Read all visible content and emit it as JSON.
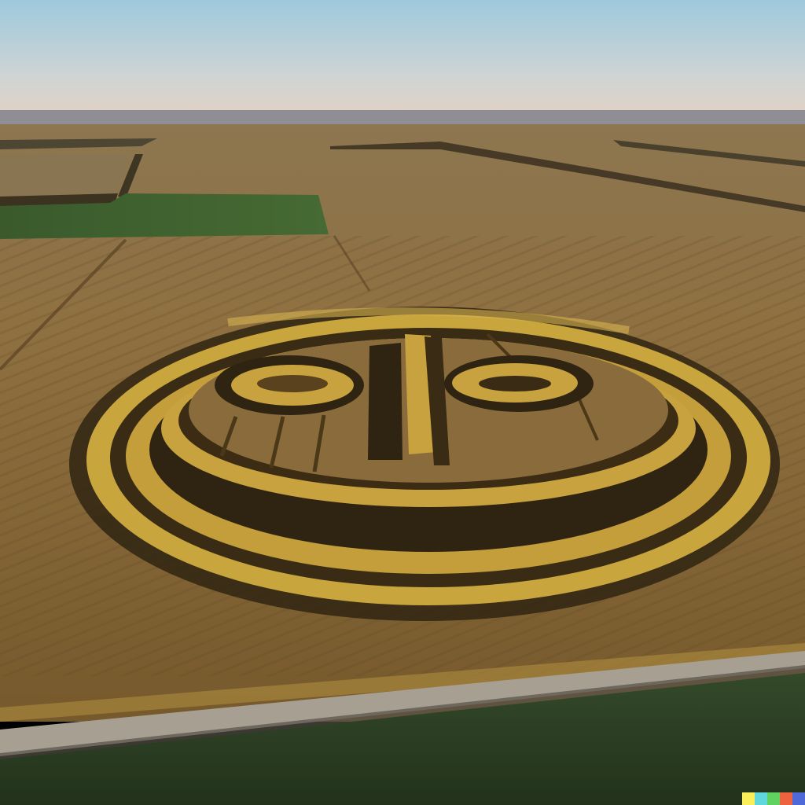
{
  "image": {
    "subject": "aerial-crop-circle-face",
    "palette": {
      "sky_top": "#9ec9dc",
      "sky_bottom": "#e2d2c4",
      "horizon": "#8e8e94",
      "field_far": "#8d7650",
      "field_mid": "#8a6c3c",
      "field_near": "#7a5e30",
      "green_patch": "#3b5a2c",
      "gold_ring": "#c9a53e",
      "dark_ring": "#2f2412",
      "road": "#a79f91",
      "grass_near": "#2c3d22"
    },
    "watermark_colors": [
      "#fbee5b",
      "#60d7dc",
      "#5fd25f",
      "#ee6240",
      "#4f6ad8"
    ]
  }
}
